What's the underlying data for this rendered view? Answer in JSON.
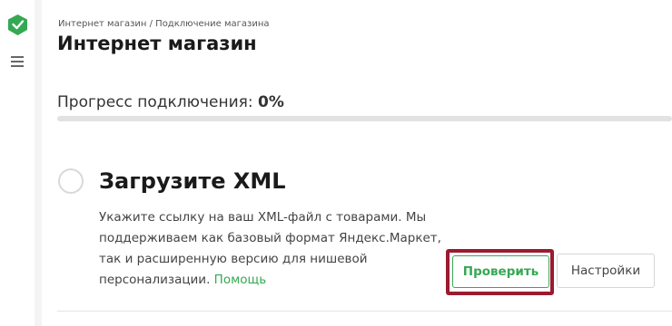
{
  "app": {
    "logo_icon": "shield-check-logo",
    "menu_icon": "hamburger-menu-icon",
    "accent_color": "#35a853"
  },
  "header": {
    "breadcrumb": "Интернет магазин / Подключение магазина",
    "title": "Интернет магазин"
  },
  "progress": {
    "label": "Прогресс подключения:",
    "value_text": "0%",
    "percent": 0
  },
  "step": {
    "title": "Загрузите XML",
    "description": "Укажите ссылку на ваш XML-файл с товарами. Мы поддерживаем как базовый формат Яндекс.Маркет, так и расширенную версию для нишевой персонализации.",
    "help_link": "Помощь",
    "check_button": "Проверить",
    "settings_button": "Настройки"
  }
}
